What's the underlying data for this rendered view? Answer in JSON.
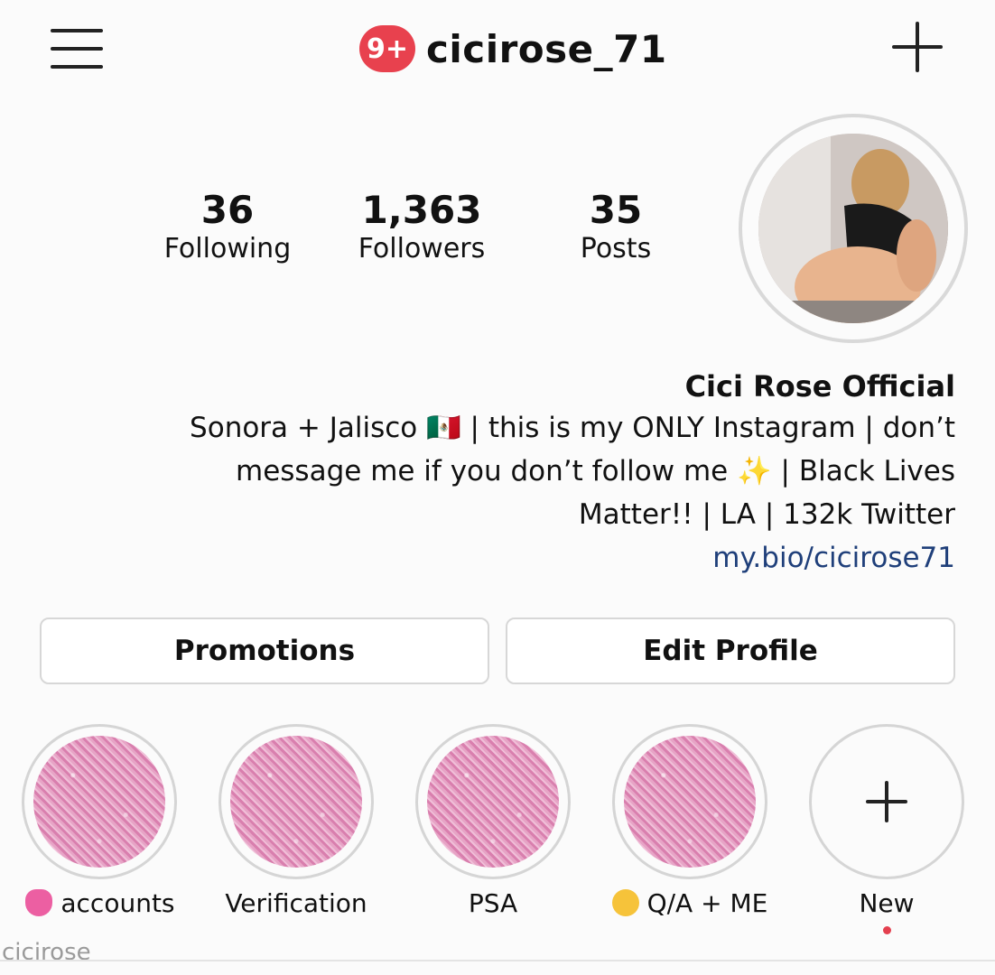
{
  "header": {
    "username": "cicirose_71",
    "notification_badge": "9+",
    "menu_icon": "hamburger-menu-icon",
    "add_icon": "plus-icon"
  },
  "stats": [
    {
      "value": "35",
      "label": "Posts"
    },
    {
      "value": "1,363",
      "label": "Followers"
    },
    {
      "value": "36",
      "label": "Following"
    }
  ],
  "bio": {
    "name": "Cici Rose Official",
    "lines": [
      "Sonora + Jalisco 🇲🇽 | this is my ONLY Instagram | don’t",
      "message me if you don’t follow me ✨ | Black Lives",
      "Matter!! | LA | 132k Twitter"
    ],
    "link": "my.bio/cicirose71"
  },
  "buttons": {
    "edit_profile": "Edit Profile",
    "promotions": "Promotions"
  },
  "highlights": [
    {
      "label": "New"
    },
    {
      "label": "Q/A + ME"
    },
    {
      "label": "PSA"
    },
    {
      "label": "Verification"
    },
    {
      "label": "accounts"
    }
  ],
  "watermark": "cicirose",
  "colors": {
    "badge": "#e8414e",
    "link": "#1f3f7a",
    "highlight_pink": "#e49bc1"
  }
}
